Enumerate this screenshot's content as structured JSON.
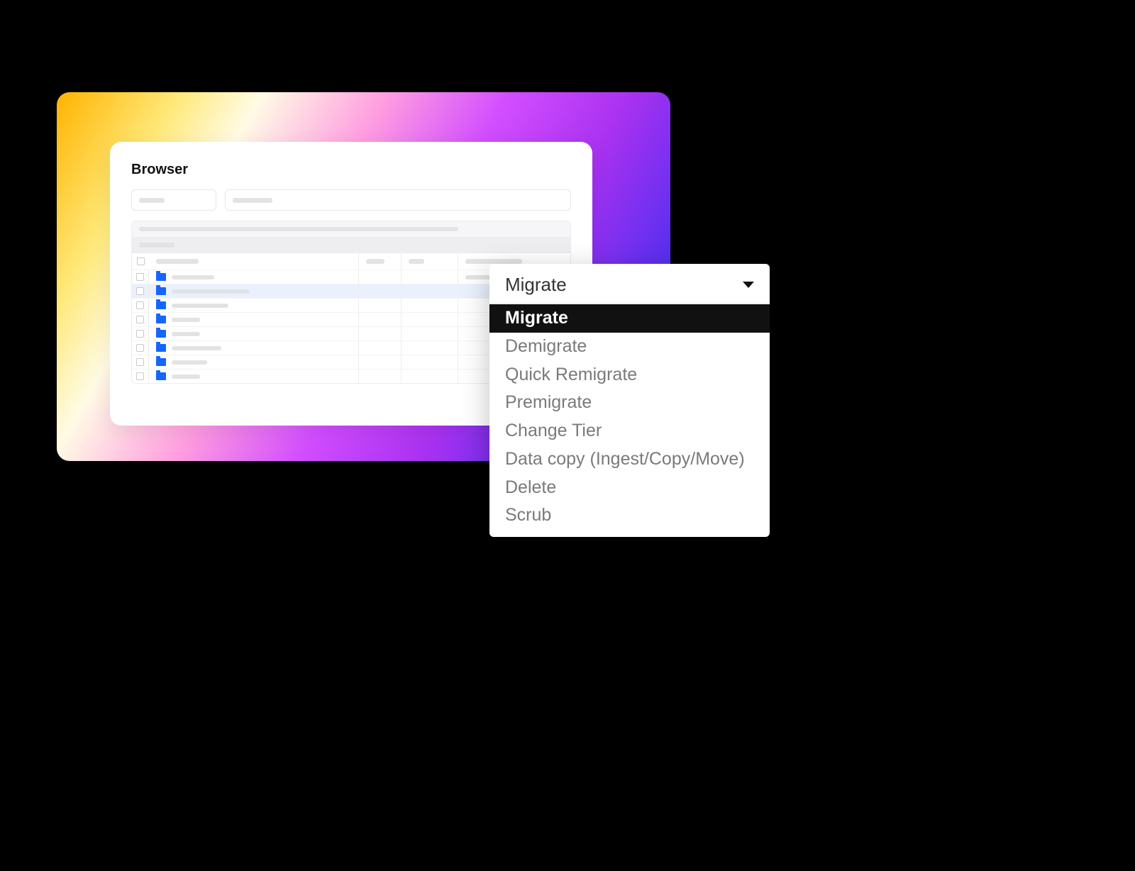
{
  "panel": {
    "title": "Browser"
  },
  "dropdown": {
    "selected": "Migrate",
    "items": [
      {
        "label": "Migrate",
        "active": true
      },
      {
        "label": "Demigrate",
        "active": false
      },
      {
        "label": "Quick Remigrate",
        "active": false
      },
      {
        "label": "Premigrate",
        "active": false
      },
      {
        "label": "Change Tier",
        "active": false
      },
      {
        "label": "Data copy (Ingest/Copy/Move)",
        "active": false
      },
      {
        "label": "Delete",
        "active": false
      },
      {
        "label": "Scrub",
        "active": false
      }
    ]
  },
  "rows": [
    {
      "selected": false,
      "nameWidth": 60
    },
    {
      "selected": true,
      "nameWidth": 110
    },
    {
      "selected": false,
      "nameWidth": 80
    },
    {
      "selected": false,
      "nameWidth": 40
    },
    {
      "selected": false,
      "nameWidth": 40
    },
    {
      "selected": false,
      "nameWidth": 70
    },
    {
      "selected": false,
      "nameWidth": 50
    },
    {
      "selected": false,
      "nameWidth": 40
    }
  ]
}
